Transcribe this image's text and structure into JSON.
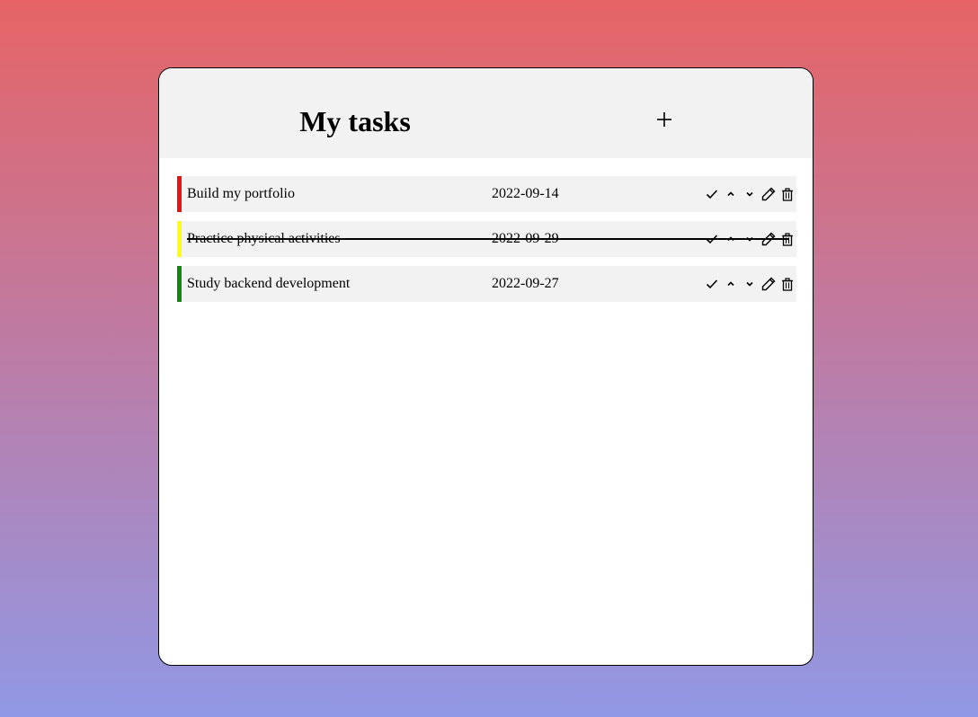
{
  "header": {
    "title": "My tasks",
    "add_icon": "plus-icon"
  },
  "tasks": [
    {
      "name": "Build my portfolio",
      "date": "2022-09-14",
      "priority_color": "#ee1111",
      "completed": false
    },
    {
      "name": "Practice physical activities",
      "date": "2022-09-29",
      "priority_color": "#ffff00",
      "completed": true
    },
    {
      "name": "Study backend development",
      "date": "2022-09-27",
      "priority_color": "#118811",
      "completed": false
    }
  ],
  "task_action_icons": [
    "check-icon",
    "chevron-up-icon",
    "chevron-down-icon",
    "pencil-icon",
    "trash-icon"
  ],
  "colors": {
    "header_bg": "#f2f2f2",
    "row_bg": "#f2f2f2",
    "gradient_top": "#e66465",
    "gradient_bottom": "#9198e5"
  }
}
